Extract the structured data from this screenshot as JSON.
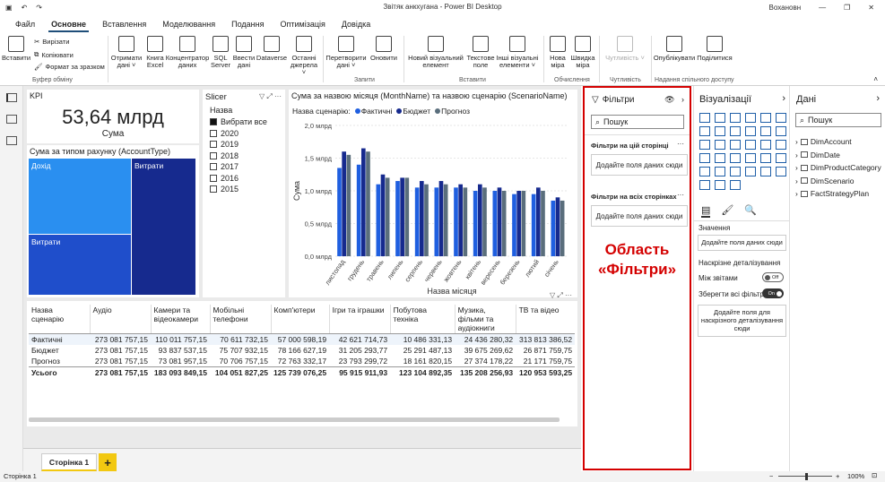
{
  "window": {
    "title": "Звітяк анкхугана - Power BI Desktop",
    "user": "Вохановн"
  },
  "menu": [
    "Файл",
    "Основне",
    "Вставлення",
    "Моделювання",
    "Подання",
    "Оптимізація",
    "Довідка"
  ],
  "menu_active": 1,
  "ribbon": {
    "paste": "Вставити",
    "cut": "Вирізати",
    "copy": "Копіювати",
    "format_painter": "Формат за зразком",
    "clipboard_group": "Буфер обміну",
    "get_data": "Отримати дані ˅",
    "excel": "Книга Excel",
    "hub": "Концентратор даних",
    "sql": "SQL Server",
    "enter_data": "Ввести дані",
    "dataverse": "Dataverse",
    "recent": "Останні джерела ˅",
    "transform": "Перетворити дані ˅",
    "refresh": "Оновити",
    "queries_group": "Запити",
    "new_visual": "Новий візуальний елемент",
    "text_box": "Текстове поле",
    "more_visuals": "Інші візуальні елементи ˅",
    "insert_group": "Вставити",
    "new_measure": "Нова міра",
    "quick_measure": "Швидка міра",
    "calc_group": "Обчислення",
    "sensitivity": "Чутливість ˅",
    "sensitivity_group": "Чутливість",
    "publish": "Опублікувати",
    "share": "Поділитися",
    "share_group": "Надання спільного доступу"
  },
  "kpi": {
    "title": "KPI",
    "value": "53,64 млрд",
    "label": "Сума"
  },
  "treemap": {
    "title": "Сума за типом рахунку (AccountType)",
    "tiles": [
      "Дохід",
      "Витрати",
      "Витрати"
    ]
  },
  "slicer": {
    "title": "Slicer",
    "header": "Назва",
    "items": [
      "Вибрати все",
      "2020",
      "2019",
      "2018",
      "2017",
      "2016",
      "2015"
    ]
  },
  "chart_data": {
    "type": "bar",
    "title": "Сума за назвою місяця (MonthName) та назвою сценарію (ScenarioName)",
    "legend_title": "Назва сценарію:",
    "xlabel": "Назва місяця",
    "ylabel": "Сума",
    "ylim": [
      0,
      2.0
    ],
    "yticks": [
      "0,0 млрд",
      "0,5 млрд",
      "1,0 млрд",
      "1,5 млрд",
      "2,0 млрд"
    ],
    "categories": [
      "листопад",
      "грудень",
      "травень",
      "липень",
      "серпень",
      "червень",
      "жовтень",
      "квітень",
      "вересень",
      "березень",
      "лютий",
      "січень"
    ],
    "series": [
      {
        "name": "Фактичні",
        "color": "#1f5fe0",
        "values": [
          1.35,
          1.4,
          1.1,
          1.15,
          1.05,
          1.05,
          1.05,
          1.0,
          1.0,
          0.95,
          0.95,
          0.85
        ]
      },
      {
        "name": "Бюджет",
        "color": "#162a8e",
        "values": [
          1.6,
          1.65,
          1.25,
          1.2,
          1.15,
          1.15,
          1.1,
          1.1,
          1.05,
          1.0,
          1.05,
          0.9
        ]
      },
      {
        "name": "Прогноз",
        "color": "#5a6e7c",
        "values": [
          1.55,
          1.6,
          1.2,
          1.2,
          1.1,
          1.1,
          1.05,
          1.05,
          1.0,
          1.0,
          1.0,
          0.85
        ]
      }
    ]
  },
  "matrix": {
    "headers": [
      "Назва сценарію",
      "Аудіо",
      "Камери та відеокамери",
      "Мобільні телефони",
      "Комп'ютери",
      "Ігри та іграшки",
      "Побутова техніка",
      "Музика, фільми та аудіокниги",
      "ТВ та відео"
    ],
    "rows": [
      [
        "Фактичні",
        "273 081 757,15",
        "110 011 757,15",
        "70 611 732,15",
        "57 000 598,19",
        "42 621 714,73",
        "10 486 331,13",
        "24 436 280,32",
        "313 813 386,52"
      ],
      [
        "Бюджет",
        "273 081 757,15",
        "93 837 537,15",
        "75 707 932,15",
        "78 166 627,19",
        "31 205 293,77",
        "25 291 487,13",
        "39 675 269,62",
        "26 871 759,75"
      ],
      [
        "Прогноз",
        "273 081 757,15",
        "73 081 957,15",
        "70 706 757,15",
        "72 763 332,17",
        "23 793 299,72",
        "18 161 820,15",
        "27 374 178,22",
        "21 171 759,75"
      ]
    ],
    "total": [
      "Усього",
      "273 081 757,15",
      "183 093 849,15",
      "104 051 827,25",
      "125 739 076,25",
      "95 915 911,93",
      "123 104 892,35",
      "135 208 256,93",
      "120 953 593,25"
    ]
  },
  "filters": {
    "title": "Фільтри",
    "search": "Пошук",
    "on_page": "Фільтри на цій сторінці",
    "on_all": "Фільтри на всіх сторінках",
    "add_field": "Додайте поля даних сюди",
    "annotation": "Область «Фільтри»",
    "annotation_color": "#d40000"
  },
  "viz": {
    "title": "Візуалізації",
    "values": "Значення",
    "add_field": "Додайте поля даних сюди",
    "drill": "Наскрізне деталізування",
    "cross_report": "Між звітами",
    "cross_report_state": "Off",
    "keep_filters": "Зберегти всі фільтри",
    "keep_filters_state": "On",
    "drill_add": "Додайте поля для наскрізного деталізування сюди"
  },
  "data": {
    "title": "Дані",
    "search": "Пошук",
    "tables": [
      "DimAccount",
      "DimDate",
      "DimProductCategory",
      "DimScenario",
      "FactStrategyPlan"
    ]
  },
  "pages": {
    "tab": "Сторінка 1",
    "add": "+"
  },
  "status": {
    "page": "Сторінка 1",
    "zoom": "100%"
  }
}
